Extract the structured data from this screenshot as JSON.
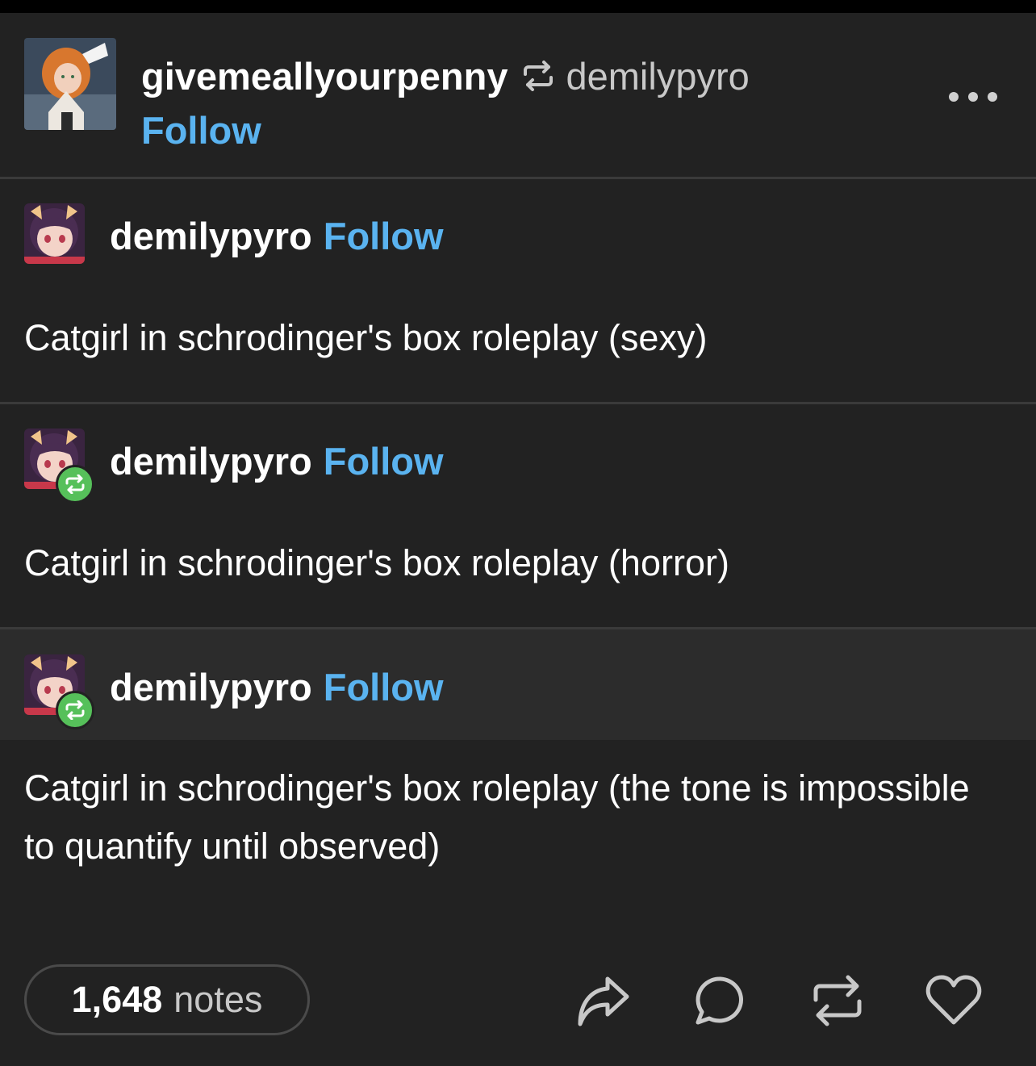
{
  "post": {
    "reblogger": "givemeallyourpenny",
    "source": "demilypyro",
    "follow_label": "Follow",
    "more_icon": "more-horizontal-icon"
  },
  "trail": [
    {
      "username": "demilypyro",
      "follow_label": "Follow",
      "text": "Catgirl in schrodinger's box roleplay (sexy)",
      "reblog_badge": false
    },
    {
      "username": "demilypyro",
      "follow_label": "Follow",
      "text": "Catgirl in schrodinger's box roleplay (horror)",
      "reblog_badge": true
    },
    {
      "username": "demilypyro",
      "follow_label": "Follow",
      "text": "Catgirl in schrodinger's box roleplay (the tone is impossible to quantify until observed)",
      "reblog_badge": true
    }
  ],
  "footer": {
    "notes_count": "1,648",
    "notes_label": "notes",
    "actions": [
      "share-icon",
      "reply-icon",
      "reblog-icon",
      "like-icon"
    ]
  },
  "colors": {
    "background": "#222222",
    "link_blue": "#5ab3f0",
    "badge_green": "#56c05a",
    "divider": "#3a3a3a"
  }
}
